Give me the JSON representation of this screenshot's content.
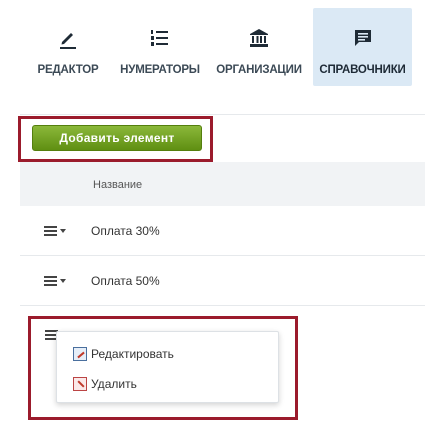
{
  "tabs": [
    {
      "label": "РЕДАКТОР",
      "icon": "pencil-icon"
    },
    {
      "label": "НУМЕРАТОРЫ",
      "icon": "numbered-list-icon"
    },
    {
      "label": "ОРГАНИЗАЦИИ",
      "icon": "bank-icon"
    },
    {
      "label": "СПРАВОЧНИКИ",
      "icon": "comment-icon",
      "active": true
    }
  ],
  "toolbar": {
    "add_label": "Добавить элемент"
  },
  "table": {
    "header": "Название",
    "rows": [
      {
        "label": "Оплата 30%"
      },
      {
        "label": "Оплата 50%"
      }
    ]
  },
  "context_menu": {
    "items": [
      {
        "label": "Редактировать",
        "icon": "edit-icon"
      },
      {
        "label": "Удалить",
        "icon": "delete-icon"
      }
    ]
  },
  "colors": {
    "accent_green": "#6f9e1f",
    "highlight_red": "#9b1b2c",
    "active_tab_bg": "#dbe9f5"
  }
}
